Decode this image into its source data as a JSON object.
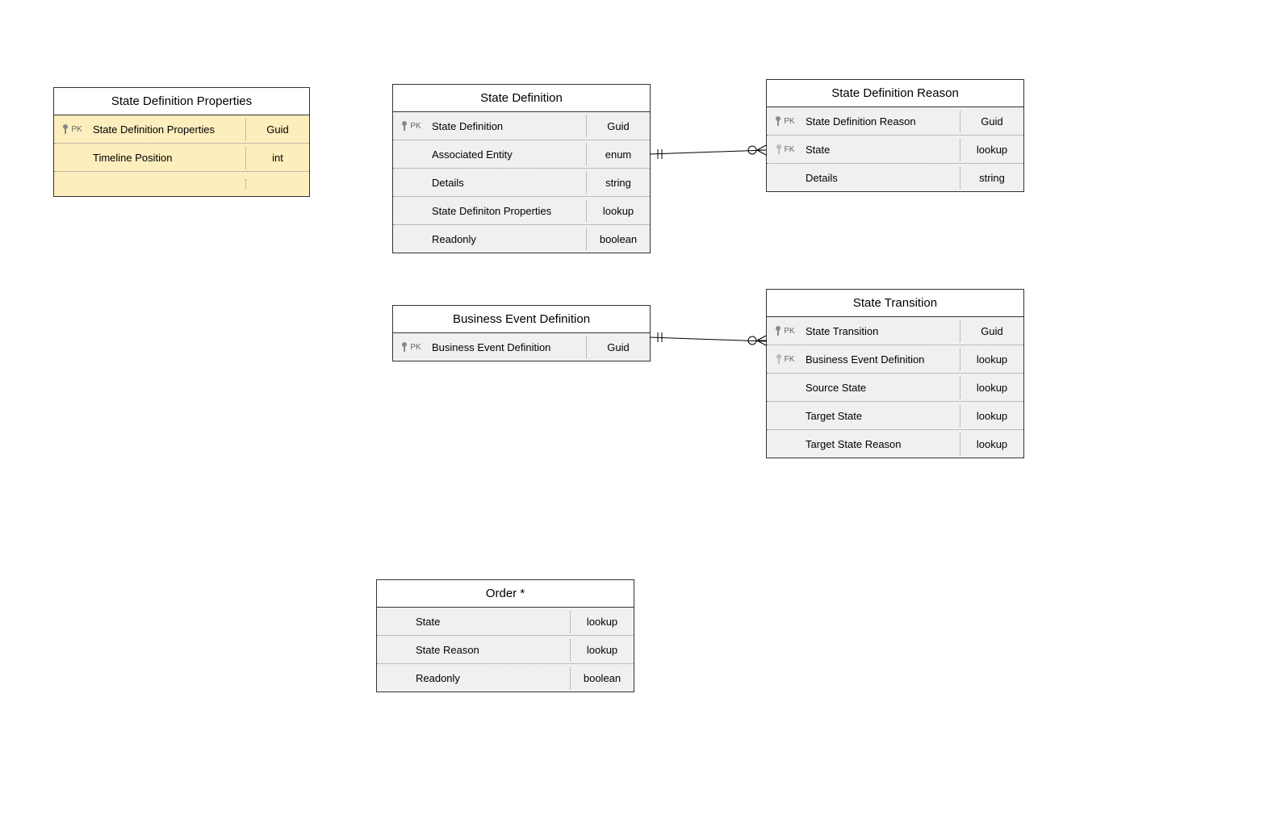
{
  "entities": {
    "stateDefProps": {
      "title": "State Definition Properties",
      "rows": [
        {
          "key": "PK",
          "name": "State Definition Properties",
          "type": "Guid"
        },
        {
          "key": "",
          "name": "Timeline Position",
          "type": "int"
        }
      ]
    },
    "stateDef": {
      "title": "State Definition",
      "rows": [
        {
          "key": "PK",
          "name": "State Definition",
          "type": "Guid"
        },
        {
          "key": "",
          "name": "Associated Entity",
          "type": "enum"
        },
        {
          "key": "",
          "name": "Details",
          "type": "string"
        },
        {
          "key": "",
          "name": "State Definiton Properties",
          "type": "lookup"
        },
        {
          "key": "",
          "name": "Readonly",
          "type": "boolean"
        }
      ]
    },
    "stateDefReason": {
      "title": "State Definition Reason",
      "rows": [
        {
          "key": "PK",
          "name": "State Definition Reason",
          "type": "Guid"
        },
        {
          "key": "FK",
          "name": "State",
          "type": "lookup"
        },
        {
          "key": "",
          "name": "Details",
          "type": "string"
        }
      ]
    },
    "bizEventDef": {
      "title": "Business Event Definition",
      "rows": [
        {
          "key": "PK",
          "name": "Business Event Definition",
          "type": "Guid"
        }
      ]
    },
    "stateTransition": {
      "title": "State Transition",
      "rows": [
        {
          "key": "PK",
          "name": "State Transition",
          "type": "Guid"
        },
        {
          "key": "FK",
          "name": "Business Event Definition",
          "type": "lookup"
        },
        {
          "key": "",
          "name": "Source State",
          "type": "lookup"
        },
        {
          "key": "",
          "name": "Target State",
          "type": "lookup"
        },
        {
          "key": "",
          "name": "Target State Reason",
          "type": "lookup"
        }
      ]
    },
    "order": {
      "title": "Order *",
      "rows": [
        {
          "key": "",
          "name": "State",
          "type": "lookup"
        },
        {
          "key": "",
          "name": "State Reason",
          "type": "lookup"
        },
        {
          "key": "",
          "name": "Readonly",
          "type": "boolean"
        }
      ]
    }
  }
}
